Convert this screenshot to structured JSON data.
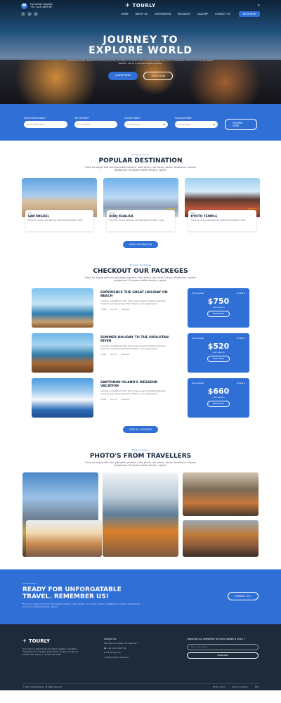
{
  "topbar": {
    "support_label": "For further inquiries",
    "phone": "+91 (123) 4567 89",
    "logo": "TOURLY"
  },
  "nav": {
    "items": [
      "HOME",
      "ABOUT US",
      "DESTINATION",
      "PACKAGES",
      "GALLERY",
      "CONTACT US"
    ],
    "book": "BOOK NOW"
  },
  "hero": {
    "title": "JOURNEY TO\nEXPLORE WORLD",
    "subtitle": "Ac mi duis mollis. Sapiente? Scelerisque quae, penatibus? Suscipit class corporis nostra rem quos voluptatibus habitant? Fames penatibus tenetur, nisi ut in sit sed fringilla gravida.",
    "btn_more": "LEARN MORE",
    "btn_book": "BOOK NOW"
  },
  "search": {
    "fields": [
      {
        "label": "Search Destination*",
        "placeholder": "Enter Destination"
      },
      {
        "label": "Pax Number*",
        "placeholder": "No.of People"
      },
      {
        "label": "Checkin Date*",
        "placeholder": "mm/dd/yyyy"
      },
      {
        "label": "Checkout Date*",
        "placeholder": "mm/dd/yyyy"
      }
    ],
    "button": "INQUIRE NOW"
  },
  "destinations": {
    "kicker": "Uncover place",
    "title": "POPULAR DESTINATION",
    "desc": "Fusce hic augue velit wisi quibusdam pariatur, iusto primis, nec nemo, rutrum. Vestibulum cumque laudantium. Sit ornare mollitia tenetur, aptent.",
    "items": [
      {
        "loc": "Italy",
        "name": "SAN MIGUEL",
        "desc": "Fusce hic augue velit wisi ips quibusdam pariatur, iusto."
      },
      {
        "loc": "Dubai",
        "name": "BURJ KHALIFA",
        "desc": "Fusce hic augue velit wisi ips quibusdam pariatur, iusto."
      },
      {
        "loc": "Japan",
        "name": "KYOTO TEMPLE",
        "desc": "Fusce hic augue velit wisi ips quibusdam pariatur, iusto."
      }
    ],
    "more": "MORE DESTINATION"
  },
  "packages": {
    "kicker": "Popular Packeges",
    "title": "CHECKOUT OUR PACKEGES",
    "desc": "Fusce hic augue velit wisi quibusdam pariatur, iusto primis, nec nemo, rutrum. Vestibulum cumque laudantium. Sit ornare mollitia tenetur, aptent.",
    "items": [
      {
        "title": "EXPERIENCE THE GREAT HOLIDAY ON BEACH",
        "desc": "Laoreet, voluptatum nihil dolor esse quaerat mattis explicabo maiores, est aliquet porttitor! Eaque, cras, aspernatur.",
        "meta": [
          "7D/6N",
          "pax: 10",
          "Malaysia"
        ],
        "reviews": "(25 reviews)",
        "price": "$750",
        "per": "/ per person",
        "book": "BOOK NOW"
      },
      {
        "title": "SUMMER HOLIDAY TO THE OXOLOTAN RIVER",
        "desc": "Laoreet, voluptatum nihil dolor esse quaerat mattis explicabo maiores, est aliquet porttitor! Eaque, cras, aspernatur.",
        "meta": [
          "7D/6N",
          "pax: 10",
          "Malaysia"
        ],
        "reviews": "(20 reviews)",
        "price": "$520",
        "per": "/ per person",
        "book": "BOOK NOW"
      },
      {
        "title": "SANTORINI ISLAND'S WEEKEND VACATION",
        "desc": "Laoreet, voluptatum nihil dolor esse quaerat mattis explicabo maiores, est aliquet porttitor! Eaque, cras, aspernatur.",
        "meta": [
          "7D/6N",
          "pax: 10",
          "Malaysia"
        ],
        "reviews": "(40 reviews)",
        "price": "$660",
        "per": "/ per person",
        "book": "BOOK NOW"
      }
    ],
    "more": "VIEW ALL PACKAGES"
  },
  "gallery": {
    "kicker": "Photo Gallery",
    "title": "PHOTO'S FROM TRAVELLERS",
    "desc": "Fusce hic augue velit wisi quibusdam pariatur, iusto primis, nec nemo, rutrum. Vestibulum cumque laudantium. Sit ornare mollitia tenetur, aptent."
  },
  "cta": {
    "kicker": "Call To Action",
    "title": "READY FOR UNFORGATABLE\nTRAVEL. REMEMBER US!",
    "desc": "Fusce hic augue velit wisi quibusdam pariatur, iusto primis, nec nemo, rutrum. Vestibulum cumque laudantium. Sit ornare mollitia tenetur, aptent.",
    "button": "CONTACT US !"
  },
  "footer": {
    "logo": "TOURLY",
    "desc": "Urna ratione ante harum provident, eleifend, vulputate molestiae proin fringilla, praesentium magna conubia at perferendis, pretium, aenean aut etiam.",
    "contact_head": "Contact Us",
    "contact_sub": "Feel free to contact and reach us !!",
    "phone": "+01 (123) 4567 90",
    "email": "info.tourly.com",
    "address": "3146 Koontz, California",
    "news_head": "Subscribe our newsletter for more update & news !!",
    "email_ph": "Enter Your Email",
    "subscribe": "SUBSCRIBE",
    "copyright": "© 2022 codewithsadee. All rights reserved",
    "links": [
      "Privacy Policy",
      "Term & Condition",
      "FAQ"
    ]
  }
}
